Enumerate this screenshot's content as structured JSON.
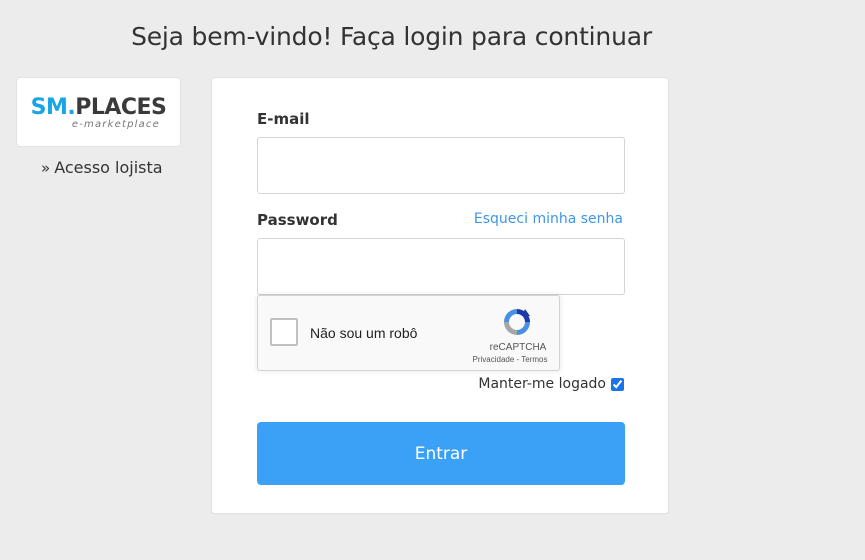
{
  "page": {
    "title": "Seja bem-vindo! Faça login para continuar"
  },
  "logo": {
    "brand_sm": "SM",
    "brand_dot": ".",
    "brand_rest": "PLACES",
    "tagline": "e-marketplace"
  },
  "shop_link": {
    "chevron": "»",
    "label": "Acesso lojista"
  },
  "form": {
    "email_label": "E-mail",
    "email_value": "",
    "password_label": "Password",
    "password_value": "",
    "forgot_link": "Esqueci minha senha",
    "recaptcha": {
      "label": "Não sou um robô",
      "brand": "reCAPTCHA",
      "privacy": "Privacidade",
      "separator": " - ",
      "terms": "Termos"
    },
    "keep_logged_label": "Manter-me logado",
    "keep_logged_checked": true,
    "submit_label": "Entrar"
  },
  "colors": {
    "background": "#ececec",
    "accent": "#3ba1f7",
    "link": "#3d96e6",
    "logo_blue": "#17a5e6"
  },
  "icons": {
    "recaptcha_logo": "recaptcha-logo-icon",
    "shop_chevron": "double-chevron-right-icon"
  }
}
